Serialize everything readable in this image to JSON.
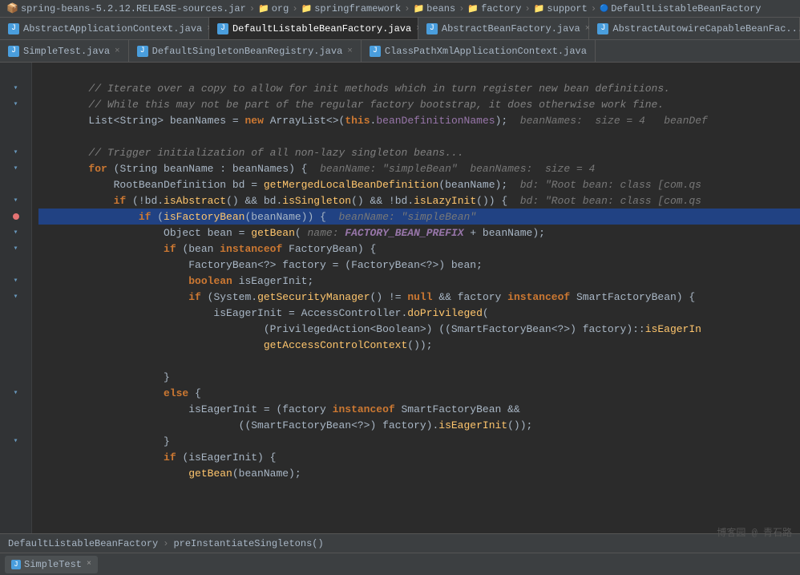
{
  "breadcrumb": {
    "items": [
      {
        "label": "spring-beans-5.2.12.RELEASE-sources.jar",
        "type": "file"
      },
      {
        "label": "org",
        "type": "folder"
      },
      {
        "label": "springframework",
        "type": "folder"
      },
      {
        "label": "beans",
        "type": "folder"
      },
      {
        "label": "factory",
        "type": "folder"
      },
      {
        "label": "support",
        "type": "folder"
      },
      {
        "label": "DefaultListableBeanFactory",
        "type": "class"
      }
    ]
  },
  "tabs_row1": [
    {
      "label": "AbstractApplicationContext.java",
      "active": false,
      "has_close": true,
      "icon": "J"
    },
    {
      "label": "DefaultListableBeanFactory.java",
      "active": true,
      "has_close": true,
      "icon": "J"
    },
    {
      "label": "AbstractBeanFactory.java",
      "active": false,
      "has_close": true,
      "icon": "J"
    },
    {
      "label": "AbstractAutowireCapableBeanFac...",
      "active": false,
      "has_close": false,
      "icon": "J"
    }
  ],
  "tabs_row2": [
    {
      "label": "SimpleTest.java",
      "active": false,
      "has_close": true,
      "icon": "J"
    },
    {
      "label": "DefaultSingletonBeanRegistry.java",
      "active": false,
      "has_close": true,
      "icon": "J"
    },
    {
      "label": "ClassPathXmlApplicationContext.java",
      "active": false,
      "has_close": false,
      "icon": "J"
    }
  ],
  "code_lines": [
    {
      "num": "",
      "content": "",
      "type": "blank"
    },
    {
      "num": "",
      "content": "        // Iterate over a copy to allow for init methods which in turn register new bean definitions.",
      "type": "comment"
    },
    {
      "num": "",
      "content": "        // While this may not be part of the regular factory bootstrap, it does otherwise work fine.",
      "type": "comment"
    },
    {
      "num": "",
      "content": "        List<String> beanNames = new ArrayList<>(this.beanDefinitionNames);  beanNames:  size = 4   beanDef",
      "type": "code"
    },
    {
      "num": "",
      "content": "",
      "type": "blank"
    },
    {
      "num": "",
      "content": "        // Trigger initialization of all non-lazy singleton beans...",
      "type": "comment"
    },
    {
      "num": "",
      "content": "        for (String beanName : beanNames) {  beanName: \"simpleBean\"  beanNames:  size = 4",
      "type": "code"
    },
    {
      "num": "",
      "content": "            RootBeanDefinition bd = getMergedLocalBeanDefinition(beanName);  bd: \"Root bean: class [com.qs",
      "type": "code",
      "has_dot": true
    },
    {
      "num": "",
      "content": "            if (!bd.isAbstract() && bd.isSingleton() && !bd.isLazyInit()) {  bd: \"Root bean: class [com.qs",
      "type": "code"
    },
    {
      "num": "",
      "content": "                if (isFactoryBean(beanName)) {  beanName: \"simpleBean\"",
      "type": "code",
      "highlighted": true
    },
    {
      "num": "",
      "content": "                    Object bean = getBean( name: FACTORY_BEAN_PREFIX + beanName);",
      "type": "code"
    },
    {
      "num": "",
      "content": "                    if (bean instanceof FactoryBean) {",
      "type": "code"
    },
    {
      "num": "",
      "content": "                        FactoryBean<?> factory = (FactoryBean<?>) bean;",
      "type": "code"
    },
    {
      "num": "",
      "content": "                        boolean isEagerInit;",
      "type": "code"
    },
    {
      "num": "",
      "content": "                        if (System.getSecurityManager() != null && factory instanceof SmartFactoryBean) {",
      "type": "code"
    },
    {
      "num": "",
      "content": "                            isEagerInit = AccessController.doPrivileged(",
      "type": "code"
    },
    {
      "num": "",
      "content": "                                    (PrivilegedAction<Boolean>) ((SmartFactoryBean<?>) factory)::isEagerIn",
      "type": "code"
    },
    {
      "num": "",
      "content": "                                    getAccessControlContext());",
      "type": "code"
    },
    {
      "num": "",
      "content": "",
      "type": "blank"
    },
    {
      "num": "",
      "content": "                    }",
      "type": "code"
    },
    {
      "num": "",
      "content": "                    else {",
      "type": "code"
    },
    {
      "num": "",
      "content": "                        isEagerInit = (factory instanceof SmartFactoryBean &&",
      "type": "code"
    },
    {
      "num": "",
      "content": "                                ((SmartFactoryBean<?>) factory).isEagerInit());",
      "type": "code"
    },
    {
      "num": "",
      "content": "                    }",
      "type": "code"
    },
    {
      "num": "",
      "content": "                    if (isEagerInit) {",
      "type": "code"
    },
    {
      "num": "",
      "content": "                        getBean(beanName);",
      "type": "code"
    }
  ],
  "bottom_breadcrumb": {
    "items": [
      "DefaultListableBeanFactory",
      "preInstantiateSingletons()"
    ]
  },
  "bottom_tabs": [
    {
      "label": "SimpleTest",
      "has_close": true,
      "icon": "J"
    }
  ],
  "watermark": "博客园 @ 青石路"
}
